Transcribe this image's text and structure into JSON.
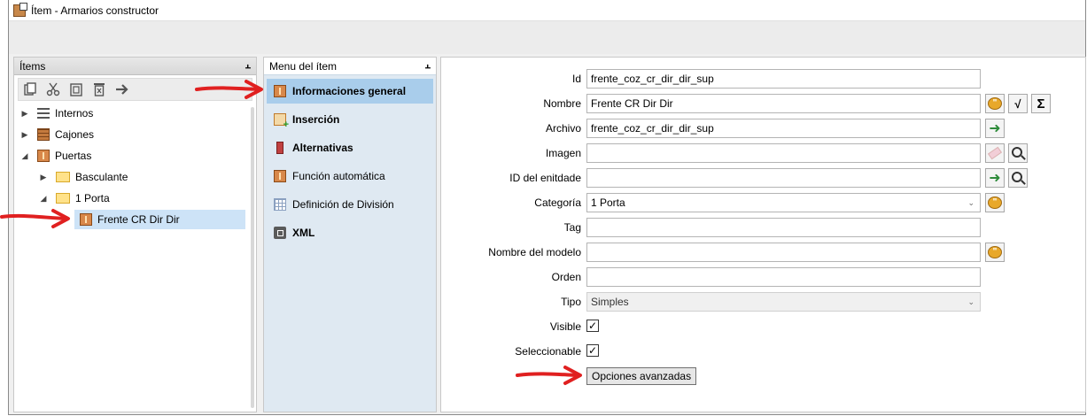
{
  "window": {
    "title": "Ítem - Armarios constructor"
  },
  "items_panel": {
    "header": "Ítems",
    "pin": "⫠",
    "toolbar": [
      "copy-icon",
      "cut-icon",
      "paste-icon",
      "delete-icon",
      "move-icon"
    ],
    "tree": [
      {
        "label": "Internos",
        "expander": "▶",
        "icon": "list-icon"
      },
      {
        "label": "Cajones",
        "expander": "▶",
        "icon": "drawer-icon"
      },
      {
        "label": "Puertas",
        "expander": "◢",
        "icon": "door-icon"
      },
      {
        "label": "Basculante",
        "expander": "▶",
        "icon": "folder-icon"
      },
      {
        "label": "1 Porta",
        "expander": "◢",
        "icon": "folder-icon"
      },
      {
        "label": "Frente CR Dir Dir",
        "expander": "",
        "icon": "door-icon"
      }
    ]
  },
  "menu_panel": {
    "header": "Menu del ítem",
    "pin": "⫠",
    "items": [
      {
        "label": "Informaciones general",
        "icon": "door-icon"
      },
      {
        "label": "Inserción",
        "icon": "insert-icon"
      },
      {
        "label": "Alternativas",
        "icon": "alternatives-icon"
      },
      {
        "label": "Función automática",
        "icon": "door-icon"
      },
      {
        "label": "Definición de División",
        "icon": "grid-icon"
      },
      {
        "label": "XML",
        "icon": "xml-icon"
      }
    ]
  },
  "form": {
    "id": {
      "label": "Id",
      "value": "frente_coz_cr_dir_dir_sup"
    },
    "nombre": {
      "label": "Nombre",
      "value": "Frente CR Dir Dir"
    },
    "archivo": {
      "label": "Archivo",
      "value": "frente_coz_cr_dir_dir_sup"
    },
    "imagen": {
      "label": "Imagen",
      "value": ""
    },
    "id_entidad": {
      "label": "ID del enitdade",
      "value": ""
    },
    "categoria": {
      "label": "Categoría",
      "value": "1 Porta"
    },
    "tag": {
      "label": "Tag",
      "value": ""
    },
    "nombre_modelo": {
      "label": "Nombre del modelo",
      "value": ""
    },
    "orden": {
      "label": "Orden",
      "value": ""
    },
    "tipo": {
      "label": "Tipo",
      "value": "Simples"
    },
    "visible": {
      "label": "Visible",
      "checked": true,
      "mark": "✓"
    },
    "seleccionable": {
      "label": "Seleccionable",
      "checked": true,
      "mark": "✓"
    },
    "advanced_button": "Opciones avanzadas",
    "dropdown_arrow": "⌄"
  },
  "colors": {
    "selection": "#cde3f7",
    "menu_active": "#a9cdeb",
    "menu_bg": "#dfe9f2",
    "annotation": "#e02020"
  }
}
